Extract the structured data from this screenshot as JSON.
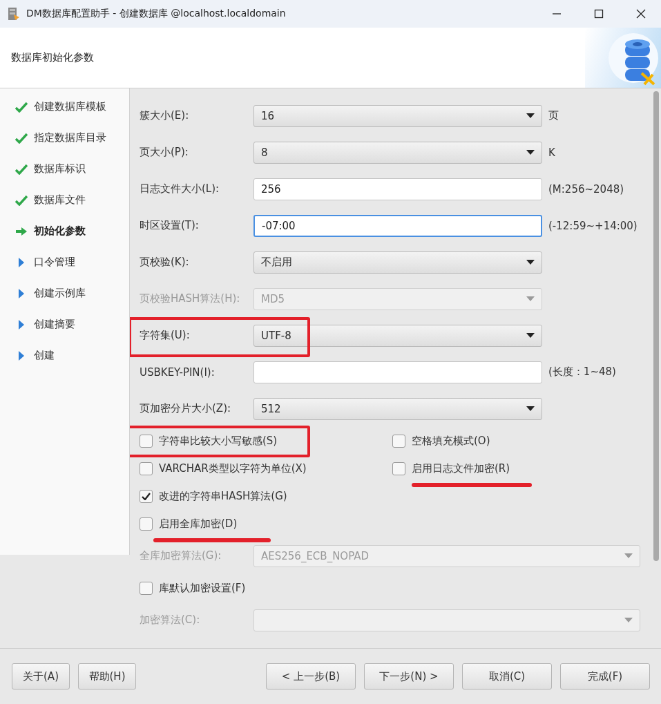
{
  "window": {
    "title": "DM数据库配置助手 - 创建数据库 @localhost.localdomain"
  },
  "header": {
    "title": "数据库初始化参数"
  },
  "steps": [
    {
      "label": "创建数据库模板",
      "completed": true,
      "selected": false
    },
    {
      "label": "指定数据库目录",
      "completed": true,
      "selected": false
    },
    {
      "label": "数据库标识",
      "completed": true,
      "selected": false
    },
    {
      "label": "数据库文件",
      "completed": true,
      "selected": false
    },
    {
      "label": "初始化参数",
      "completed": false,
      "selected": true
    },
    {
      "label": "口令管理",
      "completed": false,
      "selected": false
    },
    {
      "label": "创建示例库",
      "completed": false,
      "selected": false
    },
    {
      "label": "创建摘要",
      "completed": false,
      "selected": false
    },
    {
      "label": "创建",
      "completed": false,
      "selected": false
    }
  ],
  "form": {
    "rows": [
      {
        "kind": "select",
        "label": "簇大小(E):",
        "value": "16",
        "unit": "页",
        "disabled": false,
        "boxed": false
      },
      {
        "kind": "select",
        "label": "页大小(P):",
        "value": "8",
        "unit": "K",
        "disabled": false,
        "boxed": false
      },
      {
        "kind": "input",
        "label": "日志文件大小(L):",
        "value": "256",
        "unit": "(M:256~2048)",
        "focused": false
      },
      {
        "kind": "input",
        "label": "时区设置(T):",
        "value": "-07:00",
        "unit": "(-12:59~+14:00)",
        "focused": true
      },
      {
        "kind": "select",
        "label": "页校验(K):",
        "value": "不启用",
        "disabled": false,
        "boxed": false
      },
      {
        "kind": "select",
        "label": "页校验HASH算法(H):",
        "value": "MD5",
        "disabled": true,
        "boxed": false
      },
      {
        "kind": "select",
        "label": "字符集(U):",
        "value": "UTF-8",
        "disabled": false,
        "boxed": true
      },
      {
        "kind": "input",
        "label": "USBKEY-PIN(I):",
        "value": "",
        "unit": "(长度：1~48)",
        "focused": false
      },
      {
        "kind": "select",
        "label": "页加密分片大小(Z):",
        "value": "512",
        "disabled": false,
        "boxed": false
      },
      {
        "kind": "checks",
        "items": [
          {
            "label": "字符串比较大小写敏感(S)",
            "checked": false,
            "boxed": true,
            "underlined": false
          },
          {
            "label": "空格填充模式(O)",
            "checked": false,
            "boxed": false,
            "underlined": false
          }
        ]
      },
      {
        "kind": "checks",
        "items": [
          {
            "label": "VARCHAR类型以字符为单位(X)",
            "checked": false,
            "boxed": false,
            "underlined": false
          },
          {
            "label": "启用日志文件加密(R)",
            "checked": false,
            "boxed": false,
            "underlined": true
          }
        ]
      },
      {
        "kind": "checks",
        "items": [
          {
            "label": "改进的字符串HASH算法(G)",
            "checked": true,
            "boxed": false,
            "underlined": false
          }
        ]
      },
      {
        "kind": "checks",
        "items": [
          {
            "label": "启用全库加密(D)",
            "checked": false,
            "boxed": false,
            "underlined": true
          }
        ]
      },
      {
        "kind": "wide-select",
        "label": "全库加密算法(G):",
        "value": "AES256_ECB_NOPAD",
        "disabled": true
      },
      {
        "kind": "checks",
        "items": [
          {
            "label": "库默认加密设置(F)",
            "checked": false,
            "boxed": false,
            "underlined": false
          }
        ]
      },
      {
        "kind": "wide-select",
        "label": "加密算法(C):",
        "disabled": true
      }
    ]
  },
  "footer": {
    "left": [
      "关于(A)",
      "帮助(H)"
    ],
    "right": [
      "< 上一步(B)",
      "下一步(N) >",
      "取消(C)",
      "完成(F)"
    ]
  }
}
